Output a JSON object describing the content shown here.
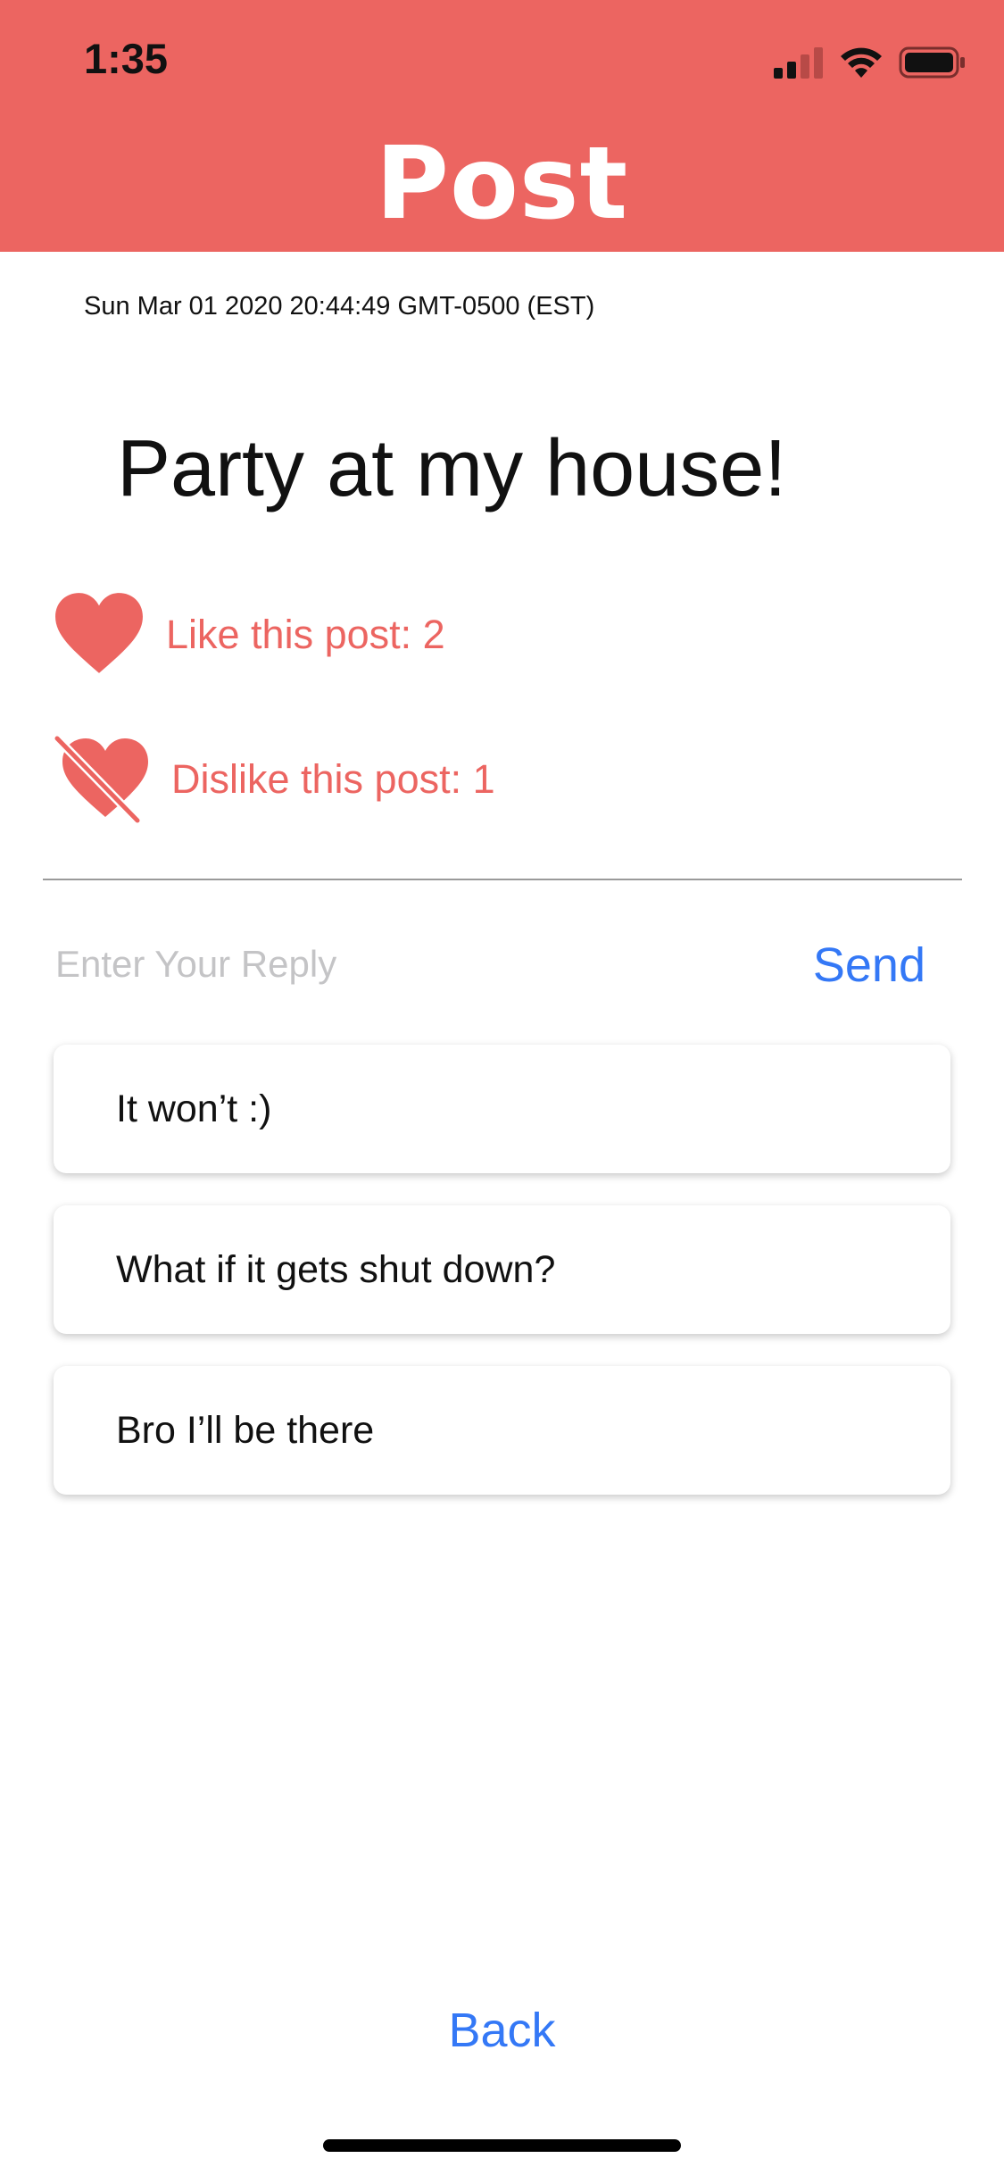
{
  "status_bar": {
    "time": "1:35",
    "icons": [
      "signal-icon",
      "wifi-icon",
      "battery-icon"
    ]
  },
  "header": {
    "title": "Post",
    "background_color": "#ec6561"
  },
  "post": {
    "date": "Sun Mar 01 2020 20:44:49 GMT-0500 (EST)",
    "title": "Party at my house!",
    "like_label": "Like this post: 2",
    "dislike_label": "Dislike this post: 1",
    "accent_color": "#ec6561"
  },
  "reply": {
    "placeholder": "Enter Your Reply",
    "value": "",
    "send_label": "Send",
    "link_color": "#3478f6"
  },
  "replies": [
    {
      "text": "It won’t :)"
    },
    {
      "text": "What if it gets shut down?"
    },
    {
      "text": "Bro I’ll be there"
    }
  ],
  "footer": {
    "back_label": "Back"
  }
}
